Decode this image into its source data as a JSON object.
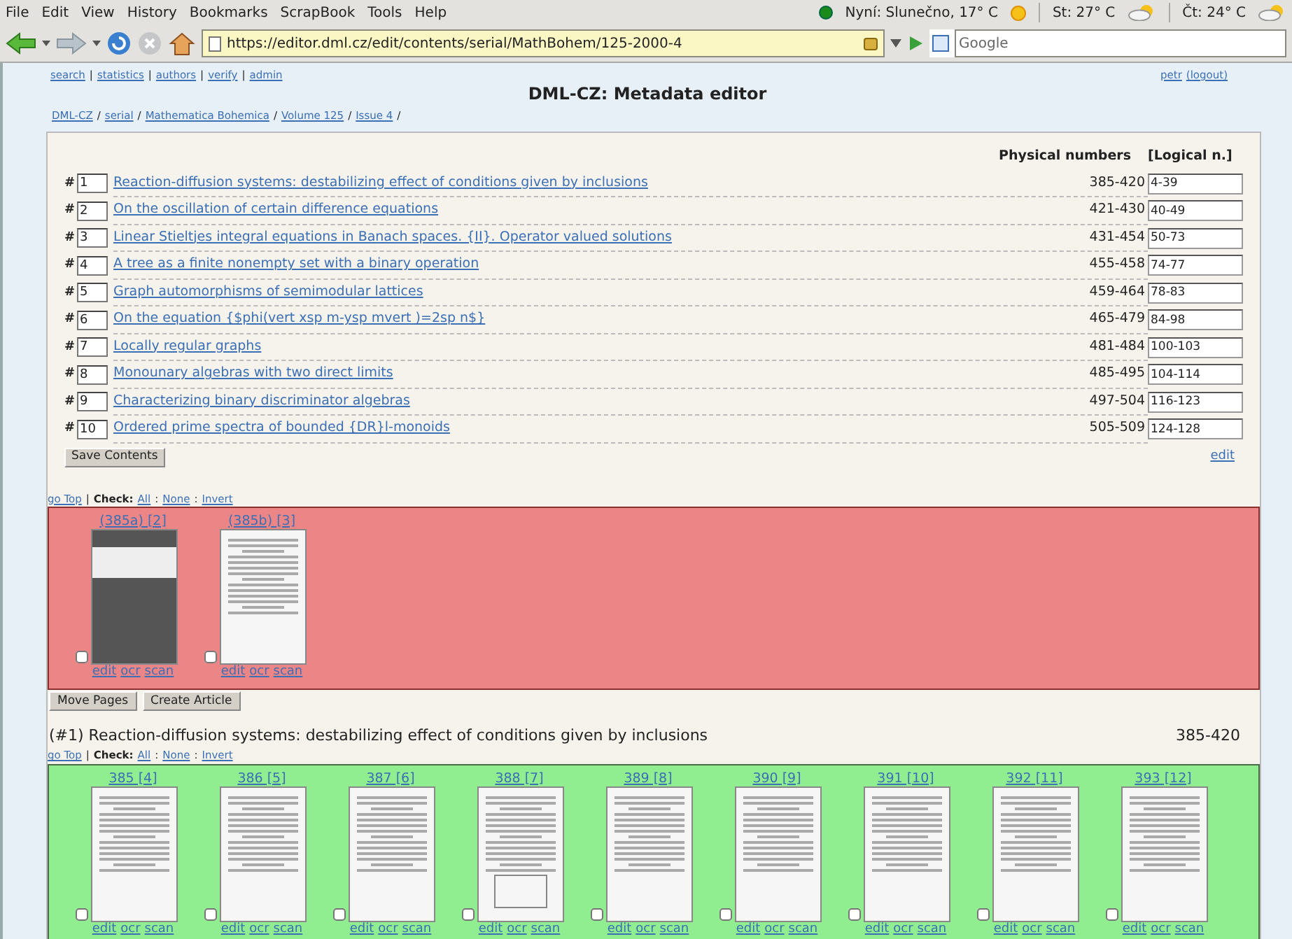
{
  "browser": {
    "menu": [
      "File",
      "Edit",
      "View",
      "History",
      "Bookmarks",
      "ScrapBook",
      "Tools",
      "Help"
    ],
    "weather": [
      {
        "text": "Nyní: Slunečno, 17° C",
        "kind": "sun"
      },
      {
        "text": "St: 27° C",
        "kind": "cloud"
      },
      {
        "text": "Čt: 24° C",
        "kind": "cloud"
      }
    ],
    "url": "https://editor.dml.cz/edit/contents/serial/MathBohem/125-2000-4",
    "search_placeholder": "Google"
  },
  "top_links": [
    "search",
    "statistics",
    "authors",
    "verify",
    "admin"
  ],
  "top_links_separator": "|",
  "breadcrumb_separator": "/",
  "row_marker": "#",
  "check_separator": "|",
  "option_separator": ":",
  "user": "petr",
  "logout": "(logout)",
  "title": "DML-CZ: Metadata editor",
  "breadcrumb": [
    "DML-CZ",
    "serial",
    "Mathematica Bohemica",
    "Volume 125",
    "Issue 4"
  ],
  "columns": {
    "physical": "Physical numbers",
    "logical": "[Logical n.]"
  },
  "articles": [
    {
      "num": "1",
      "title": "Reaction-diffusion systems: destabilizing effect of conditions given by inclusions",
      "physical": "385-420",
      "logical": "4-39"
    },
    {
      "num": "2",
      "title": "On the oscillation of certain difference equations",
      "physical": "421-430",
      "logical": "40-49"
    },
    {
      "num": "3",
      "title": "Linear Stieltjes integral equations in Banach spaces. {II}. Operator valued solutions",
      "physical": "431-454",
      "logical": "50-73"
    },
    {
      "num": "4",
      "title": "A tree as a finite nonempty set with a binary operation",
      "physical": "455-458",
      "logical": "74-77"
    },
    {
      "num": "5",
      "title": "Graph automorphisms of semimodular lattices",
      "physical": "459-464",
      "logical": "78-83"
    },
    {
      "num": "6",
      "title": "On the equation {$phi(vert xsp m-ysp mvert )=2sp n$}",
      "physical": "465-479",
      "logical": "84-98"
    },
    {
      "num": "7",
      "title": "Locally regular graphs",
      "physical": "481-484",
      "logical": "100-103"
    },
    {
      "num": "8",
      "title": "Monounary algebras with two direct limits",
      "physical": "485-495",
      "logical": "104-114"
    },
    {
      "num": "9",
      "title": "Characterizing binary discriminator algebras",
      "physical": "497-504",
      "logical": "116-123"
    },
    {
      "num": "10",
      "title": "Ordered prime spectra of bounded {DR}l-monoids",
      "physical": "505-509",
      "logical": "124-128"
    }
  ],
  "save_button": "Save Contents",
  "edit_link": "edit",
  "sections": [
    {
      "kind": "unassigned",
      "go_top": "go Top",
      "check_label": "Check:",
      "check_options": [
        "All",
        "None",
        "Invert"
      ],
      "pages": [
        {
          "label": "(385a) [2]",
          "kind": "cover",
          "checked": false,
          "actions": [
            "edit",
            "ocr",
            "scan"
          ]
        },
        {
          "label": "(385b) [3]",
          "kind": "text",
          "checked": false,
          "actions": [
            "edit",
            "ocr",
            "scan"
          ]
        }
      ],
      "buttons": [
        "Move Pages",
        "Create Article"
      ]
    },
    {
      "kind": "article",
      "heading": "(#1) Reaction-diffusion systems: destabilizing effect of conditions given by inclusions",
      "range": "385-420",
      "go_top": "go Top",
      "check_label": "Check:",
      "check_options": [
        "All",
        "None",
        "Invert"
      ],
      "pages": [
        {
          "label": "385 [4]",
          "kind": "text",
          "checked": false,
          "actions": [
            "edit",
            "ocr",
            "scan"
          ]
        },
        {
          "label": "386 [5]",
          "kind": "text",
          "checked": false,
          "actions": [
            "edit",
            "ocr",
            "scan"
          ]
        },
        {
          "label": "387 [6]",
          "kind": "text",
          "checked": false,
          "actions": [
            "edit",
            "ocr",
            "scan"
          ]
        },
        {
          "label": "388 [7]",
          "kind": "figure",
          "checked": false,
          "actions": [
            "edit",
            "ocr",
            "scan"
          ]
        },
        {
          "label": "389 [8]",
          "kind": "text",
          "checked": false,
          "actions": [
            "edit",
            "ocr",
            "scan"
          ]
        },
        {
          "label": "390 [9]",
          "kind": "text",
          "checked": false,
          "actions": [
            "edit",
            "ocr",
            "scan"
          ]
        },
        {
          "label": "391 [10]",
          "kind": "text",
          "checked": false,
          "actions": [
            "edit",
            "ocr",
            "scan"
          ]
        },
        {
          "label": "392 [11]",
          "kind": "text",
          "checked": false,
          "actions": [
            "edit",
            "ocr",
            "scan"
          ]
        },
        {
          "label": "393 [12]",
          "kind": "text",
          "checked": false,
          "actions": [
            "edit",
            "ocr",
            "scan"
          ]
        }
      ]
    }
  ]
}
